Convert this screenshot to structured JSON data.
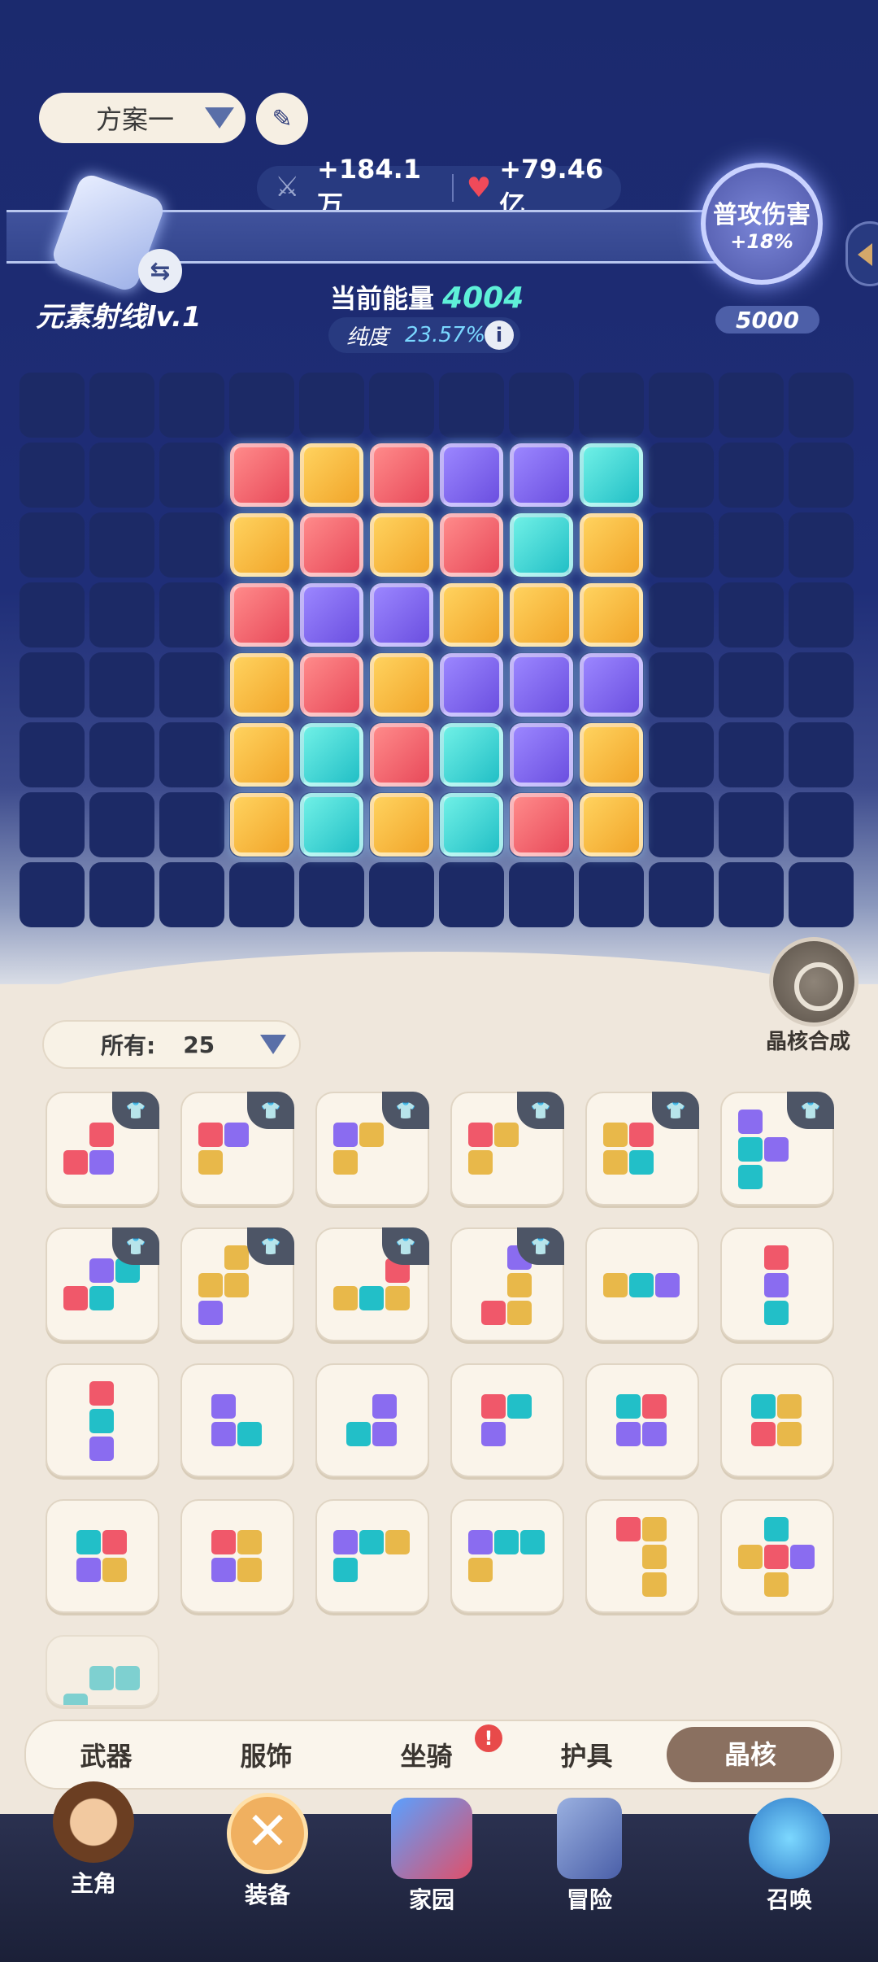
{
  "plan": {
    "label": "方案一"
  },
  "stats": {
    "attack": "+184.1万",
    "hp": "+79.46亿"
  },
  "core": {
    "name": "元素射线lv.1",
    "energy_label": "当前能量",
    "energy_value": "4004",
    "purity_label": "纯度",
    "purity_value": "23.57%"
  },
  "bonus": {
    "title": "普攻伤害",
    "value": "+18%",
    "cost": "5000"
  },
  "board": {
    "rows": [
      [
        "red",
        "orange",
        "red",
        "purple",
        "purple",
        "cyan"
      ],
      [
        "orange",
        "red",
        "orange",
        "red",
        "cyan",
        "orange"
      ],
      [
        "red",
        "purple",
        "purple",
        "orange",
        "orange",
        "orange"
      ],
      [
        "orange",
        "red",
        "orange",
        "purple",
        "purple",
        "purple"
      ],
      [
        "orange",
        "cyan",
        "red",
        "cyan",
        "purple",
        "orange"
      ],
      [
        "orange",
        "cyan",
        "orange",
        "cyan",
        "red",
        "orange"
      ]
    ]
  },
  "synth": {
    "label": "晶核合成"
  },
  "filter": {
    "label": "所有:",
    "count": "25"
  },
  "tabs": [
    "武器",
    "服饰",
    "坐骑",
    "护具",
    "晶核"
  ],
  "badge": "!",
  "nav": [
    "主角",
    "装备",
    "家园",
    "冒险",
    "召唤"
  ]
}
